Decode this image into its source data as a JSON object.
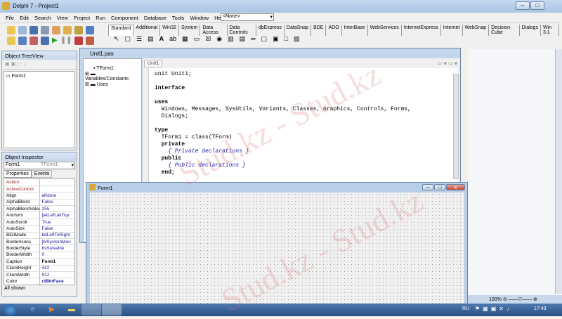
{
  "window": {
    "title": "Delphi 7 - Project1"
  },
  "menu": [
    "File",
    "Edit",
    "Search",
    "View",
    "Project",
    "Run",
    "Component",
    "Database",
    "Tools",
    "Window",
    "Help"
  ],
  "component_select": "<None>",
  "palette_tabs": [
    "Standard",
    "Additional",
    "Win32",
    "System",
    "Data Access",
    "Data Controls",
    "dbExpress",
    "DataSnap",
    "BDE",
    "ADO",
    "InterBase",
    "WebServices",
    "InternetExpress",
    "Internet",
    "WebSnap",
    "Decision Cube",
    "Dialogs",
    "Win 3.1"
  ],
  "treeview": {
    "title": "Object TreeView",
    "items": [
      "Form1"
    ]
  },
  "inspector": {
    "title": "Object Inspector",
    "object": "Form1",
    "type": "TForm1",
    "tabs": [
      "Properties",
      "Events"
    ],
    "props": [
      [
        "Action",
        ""
      ],
      [
        "ActiveControl",
        ""
      ],
      [
        "Align",
        "alNone"
      ],
      [
        "AlphaBlend",
        "False"
      ],
      [
        "AlphaBlendValue",
        "255"
      ],
      [
        "Anchors",
        "[akLeft,akTop"
      ],
      [
        "AutoScroll",
        "True"
      ],
      [
        "AutoSize",
        "False"
      ],
      [
        "BiDiMode",
        "bdLeftToRight"
      ],
      [
        "BorderIcons",
        "[biSystemMen"
      ],
      [
        "BorderStyle",
        "bsSizeable"
      ],
      [
        "BorderWidth",
        "0"
      ],
      [
        "Caption",
        "Form1"
      ],
      [
        "ClientHeight",
        "442"
      ],
      [
        "ClientWidth",
        "912"
      ],
      [
        "Color",
        "clBtnFace"
      ]
    ],
    "status": "All shown"
  },
  "editor": {
    "title": "Unit1.pas",
    "tab": "Unit1",
    "explorer": [
      "TForm1",
      "Variables/Constants",
      "Uses"
    ],
    "code": [
      "unit Unit1;",
      "",
      "interface",
      "",
      "uses",
      "  Windows, Messages, SysUtils, Variants, Classes, Graphics, Controls, Forms,",
      "  Dialogs;",
      "",
      "type",
      "  TForm1 = class(TForm)",
      "  private",
      "    { Private declarations }",
      "  public",
      "    { Public declarations }",
      "  end;"
    ]
  },
  "form": {
    "title": "Form1"
  },
  "word": {
    "zoom": "100%"
  },
  "tray": {
    "lang": "RU",
    "time": "17:43"
  },
  "watermark": "Stud.kz - Stud.kz"
}
